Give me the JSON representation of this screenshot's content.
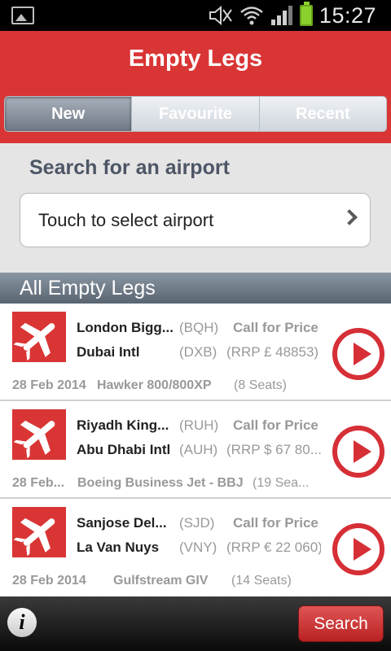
{
  "status_bar": {
    "time": "15:27"
  },
  "header": {
    "title": "Empty Legs"
  },
  "tabs": [
    {
      "label": "New",
      "active": true
    },
    {
      "label": "Favourite",
      "active": false
    },
    {
      "label": "Recent",
      "active": false
    }
  ],
  "search": {
    "heading": "Search for an airport",
    "airport_placeholder": "Touch to select airport"
  },
  "section": {
    "title": "All Empty Legs"
  },
  "legs": [
    {
      "from_name": "London Bigg...",
      "from_code": "(BQH)",
      "to_name": "Dubai Intl",
      "to_code": "(DXB)",
      "price_top": "Call for Price",
      "price_rrp": "(RRP £ 48853)",
      "date": "28 Feb 2014",
      "aircraft": "Hawker 800/800XP",
      "seats": "(8 Seats)"
    },
    {
      "from_name": "Riyadh King...",
      "from_code": "(RUH)",
      "to_name": "Abu Dhabi Intl",
      "to_code": "(AUH)",
      "price_top": "Call for Price",
      "price_rrp": "(RRP $ 67 80...",
      "date": "28 Feb...",
      "aircraft": "Boeing Business Jet - BBJ",
      "seats": "(19 Sea..."
    },
    {
      "from_name": "Sanjose Del...",
      "from_code": "(SJD)",
      "to_name": "La Van Nuys",
      "to_code": "(VNY)",
      "price_top": "Call for Price",
      "price_rrp": "(RRP € 22 060)",
      "date": "28 Feb 2014",
      "aircraft": "Gulfstream GIV",
      "seats": "(14 Seats)"
    }
  ],
  "bottom_bar": {
    "info_label": "i",
    "search_label": "Search"
  },
  "colors": {
    "brand_red": "#d93535",
    "play_red": "#d62f36",
    "battery_green": "#8bd12d"
  },
  "icons": [
    "gallery-icon",
    "mute-icon",
    "wifi-icon",
    "signal-icon",
    "battery-icon",
    "plane-icon",
    "chevron-right-icon",
    "play-icon",
    "info-icon"
  ]
}
